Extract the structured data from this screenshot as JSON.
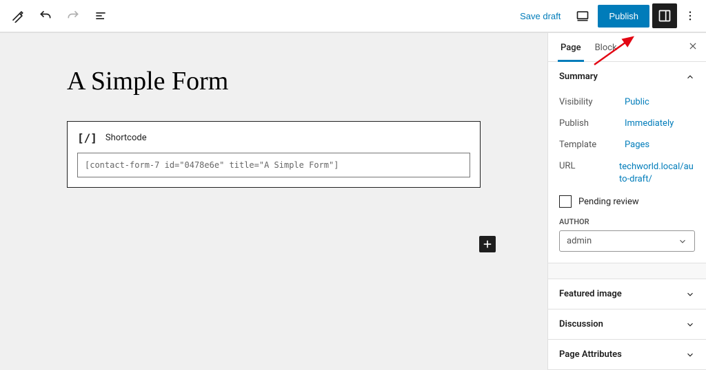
{
  "toolbar": {
    "save_draft": "Save draft",
    "publish": "Publish"
  },
  "arrow": {
    "color": "#e30613"
  },
  "canvas": {
    "page_title": "A Simple Form",
    "shortcode": {
      "label": "Shortcode",
      "icon_text": "[/]",
      "value": "[contact-form-7 id=\"0478e6e\" title=\"A Simple Form\"]"
    }
  },
  "inspector": {
    "tabs": {
      "page": "Page",
      "block": "Block"
    },
    "summary": {
      "title": "Summary",
      "visibility": {
        "label": "Visibility",
        "value": "Public"
      },
      "publish": {
        "label": "Publish",
        "value": "Immediately"
      },
      "template": {
        "label": "Template",
        "value": "Pages"
      },
      "url": {
        "label": "URL",
        "value": "techworld.local/auto-draft/"
      },
      "pending": {
        "label": "Pending review"
      },
      "author_label": "AUTHOR",
      "author_value": "admin"
    },
    "panels": {
      "featured_image": "Featured image",
      "discussion": "Discussion",
      "page_attributes": "Page Attributes"
    }
  }
}
